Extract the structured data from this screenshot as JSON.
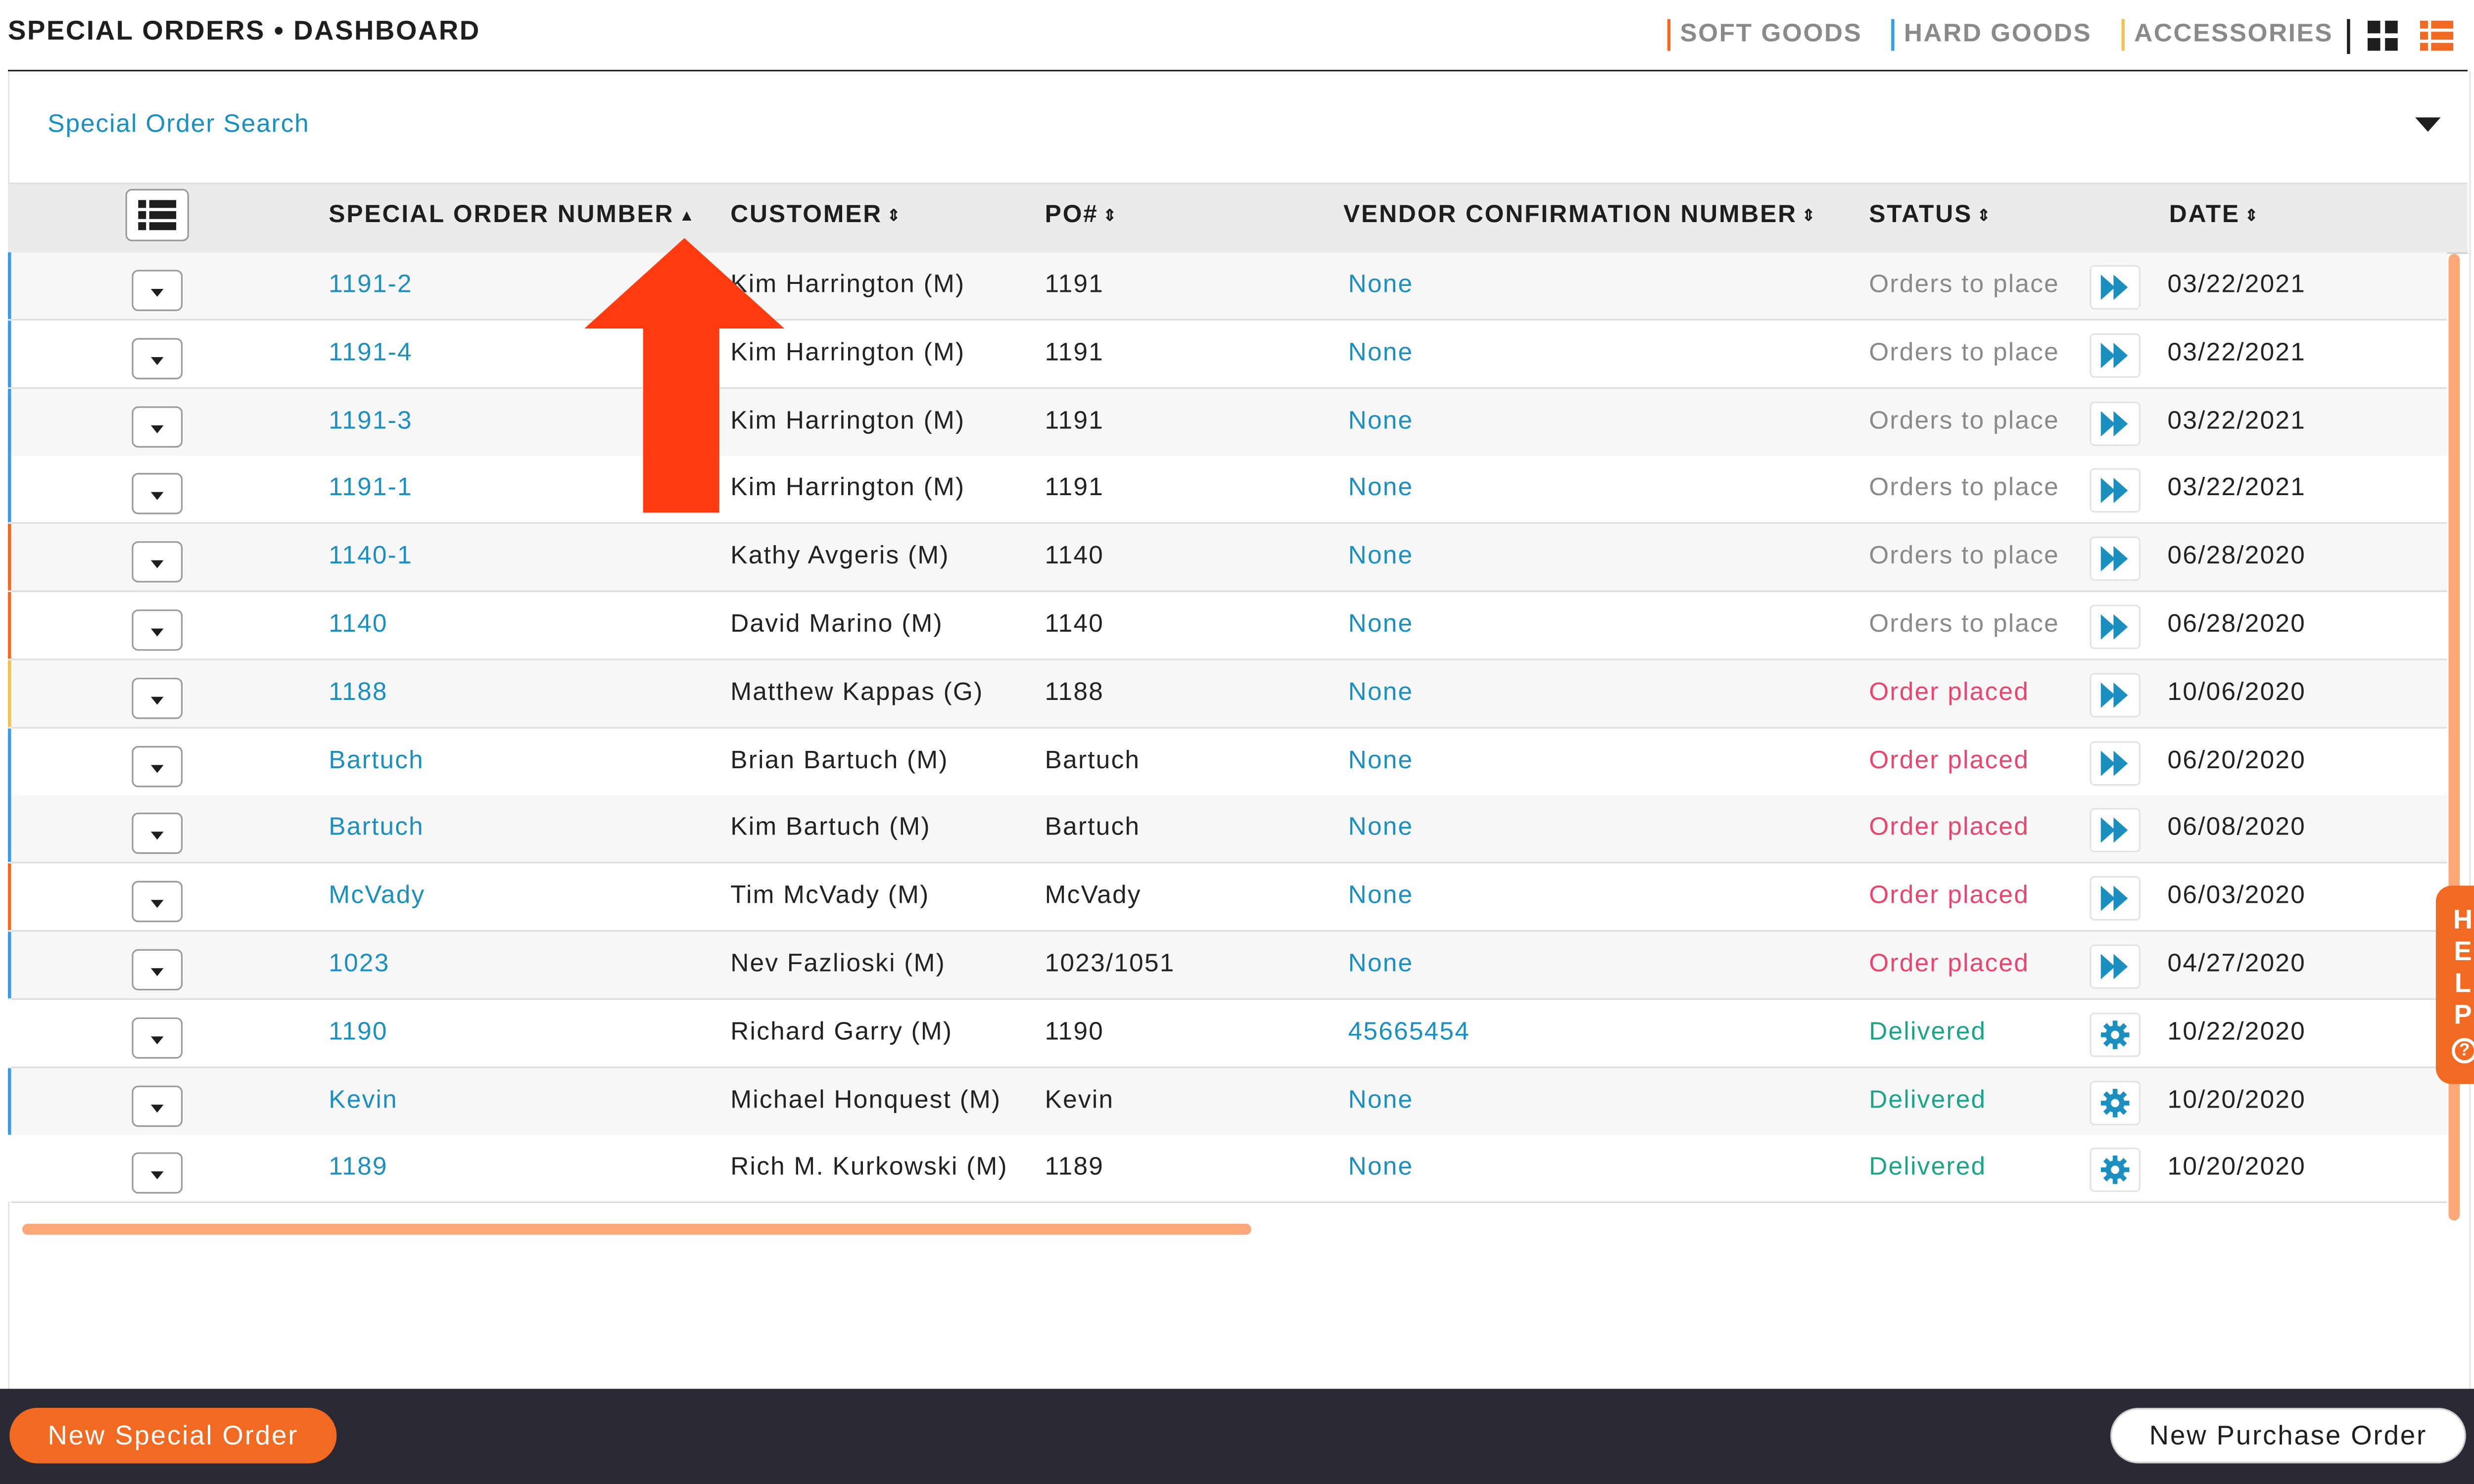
{
  "header": {
    "title": "SPECIAL ORDERS • DASHBOARD",
    "categories": [
      {
        "label": "SOFT GOODS",
        "color": "#f26a21"
      },
      {
        "label": "HARD GOODS",
        "color": "#3b9be8"
      },
      {
        "label": "ACCESSORIES",
        "color": "#f2c14e"
      }
    ],
    "view_icons": [
      "grid-view-icon",
      "list-view-icon"
    ]
  },
  "search": {
    "label": "Special Order Search"
  },
  "table": {
    "columns": [
      {
        "label": "SPECIAL ORDER NUMBER",
        "sort": "▲"
      },
      {
        "label": "CUSTOMER",
        "sort": "⇕"
      },
      {
        "label": "PO#",
        "sort": "⇕"
      },
      {
        "label": "VENDOR CONFIRMATION NUMBER",
        "sort": "⇕"
      },
      {
        "label": "STATUS",
        "sort": "⇕"
      },
      {
        "label": "DATE",
        "sort": "⇕"
      }
    ],
    "rows": [
      {
        "number": "1191-2",
        "customer": "Kim Harrington (M)",
        "po": "1191",
        "vendor": "None",
        "status": "Orders to place",
        "date": "03/22/2021",
        "category_color": "#3b9be8"
      },
      {
        "number": "1191-4",
        "customer": "Kim Harrington (M)",
        "po": "1191",
        "vendor": "None",
        "status": "Orders to place",
        "date": "03/22/2021",
        "category_color": "#3b9be8"
      },
      {
        "number": "1191-3",
        "customer": "Kim Harrington (M)",
        "po": "1191",
        "vendor": "None",
        "status": "Orders to place",
        "date": "03/22/2021",
        "category_color": "#3b9be8"
      },
      {
        "number": "1191-1",
        "customer": "Kim Harrington (M)",
        "po": "1191",
        "vendor": "None",
        "status": "Orders to place",
        "date": "03/22/2021",
        "category_color": "#3b9be8"
      },
      {
        "number": "1140-1",
        "customer": "Kathy Avgeris (M)",
        "po": "1140",
        "vendor": "None",
        "status": "Orders to place",
        "date": "06/28/2020",
        "category_color": "#f26a21"
      },
      {
        "number": "1140",
        "customer": "David Marino (M)",
        "po": "1140",
        "vendor": "None",
        "status": "Orders to place",
        "date": "06/28/2020",
        "category_color": "#f26a21"
      },
      {
        "number": "1188",
        "customer": "Matthew Kappas (G)",
        "po": "1188",
        "vendor": "None",
        "status": "Order placed",
        "date": "10/06/2020",
        "category_color": "#f2c14e"
      },
      {
        "number": "Bartuch",
        "customer": "Brian Bartuch (M)",
        "po": "Bartuch",
        "vendor": "None",
        "status": "Order placed",
        "date": "06/20/2020",
        "category_color": "#3b9be8"
      },
      {
        "number": "Bartuch",
        "customer": "Kim Bartuch (M)",
        "po": "Bartuch",
        "vendor": "None",
        "status": "Order placed",
        "date": "06/08/2020",
        "category_color": "#3b9be8"
      },
      {
        "number": "McVady",
        "customer": "Tim McVady (M)",
        "po": "McVady",
        "vendor": "None",
        "status": "Order placed",
        "date": "06/03/2020",
        "category_color": "#f26a21"
      },
      {
        "number": "1023",
        "customer": "Nev Fazlioski (M)",
        "po": "1023/1051",
        "vendor": "None",
        "status": "Order placed",
        "date": "04/27/2020",
        "category_color": "#3b9be8"
      },
      {
        "number": "1190",
        "customer": "Richard Garry (M)",
        "po": "1190",
        "vendor": "45665454",
        "status": "Delivered",
        "date": "10/22/2020",
        "category_color": "#ffffff"
      },
      {
        "number": "Kevin",
        "customer": "Michael Honquest (M)",
        "po": "Kevin",
        "vendor": "None",
        "status": "Delivered",
        "date": "10/20/2020",
        "category_color": "#3b9be8"
      },
      {
        "number": "1189",
        "customer": "Rich M. Kurkowski (M)",
        "po": "1189",
        "vendor": "None",
        "status": "Delivered",
        "date": "10/20/2020",
        "category_color": "#ffffff"
      }
    ]
  },
  "status_styles": {
    "Orders to place": {
      "color": "#8a8a8a",
      "action_icon": "fast-forward-icon"
    },
    "Order placed": {
      "color": "#e8466e",
      "action_icon": "fast-forward-icon"
    },
    "Delivered": {
      "color": "#1aa58a",
      "action_icon": "gear-icon"
    }
  },
  "help": {
    "label": "HELP",
    "icon": "question-circle-icon"
  },
  "footer": {
    "new_special_order": "New Special Order",
    "new_purchase_order": "New Purchase Order"
  },
  "colors": {
    "accent": "#f26a21",
    "link": "#1a8fc0",
    "footer_bg": "#2a2a35"
  }
}
